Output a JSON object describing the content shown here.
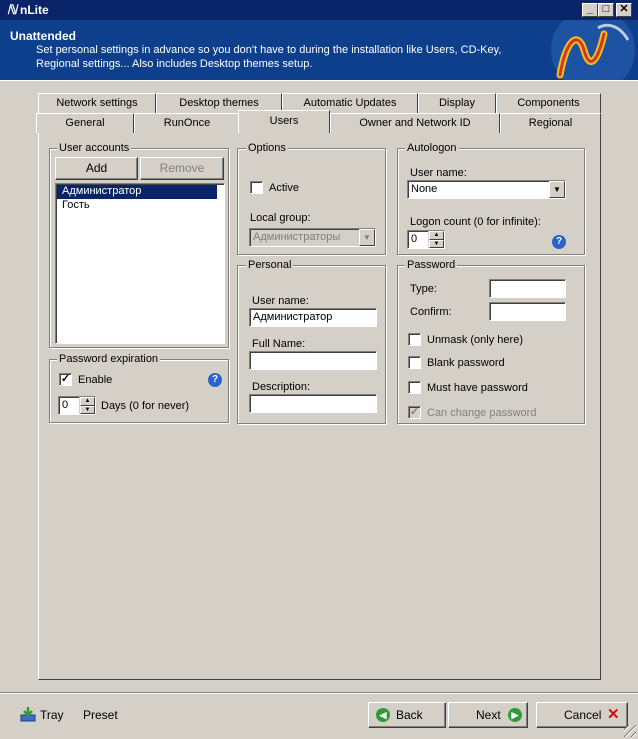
{
  "window": {
    "title": "nLite",
    "minimize": "_",
    "maximize": "□",
    "close": "✕"
  },
  "banner": {
    "heading": "Unattended",
    "description": "Set personal settings in advance so you don't have to during the installation like Users, CD-Key, Regional settings... Also includes Desktop themes setup."
  },
  "tabs_row1": [
    "Network settings",
    "Desktop themes",
    "Automatic Updates",
    "Display",
    "Components"
  ],
  "tabs_row2": [
    "General",
    "RunOnce",
    "Users",
    "Owner and Network ID",
    "Regional"
  ],
  "selected_tab": "Users",
  "user_accounts": {
    "title": "User accounts",
    "add_label": "Add",
    "remove_label": "Remove",
    "items": [
      "Администратор",
      "Гость"
    ],
    "selected": "Администратор"
  },
  "password_expiration": {
    "title": "Password expiration",
    "enable_label": "Enable",
    "enabled": true,
    "days_value": "0",
    "days_label": "Days (0 for never)"
  },
  "options": {
    "title": "Options",
    "active_label": "Active",
    "active": false,
    "local_group_label": "Local group:",
    "local_group_value": "Администраторы"
  },
  "personal": {
    "title": "Personal",
    "user_name_label": "User name:",
    "user_name_value": "Администратор",
    "full_name_label": "Full Name:",
    "full_name_value": "",
    "description_label": "Description:",
    "description_value": ""
  },
  "autologon": {
    "title": "Autologon",
    "user_name_label": "User name:",
    "user_name_value": "None",
    "logon_count_label": "Logon count (0 for infinite):",
    "logon_count_value": "0"
  },
  "password": {
    "title": "Password",
    "type_label": "Type:",
    "confirm_label": "Confirm:",
    "unmask_label": "Unmask (only here)",
    "blank_label": "Blank password",
    "must_have_label": "Must have password",
    "can_change_label": "Can change password",
    "unmask": false,
    "blank": false,
    "must_have": false,
    "can_change": true
  },
  "footer": {
    "tray_label": "Tray",
    "preset_label": "Preset",
    "back_label": "Back",
    "next_label": "Next",
    "cancel_label": "Cancel"
  },
  "icons": {
    "help": "help-icon",
    "tray": "tray-icon",
    "back": "back-arrow-icon",
    "next": "next-arrow-icon",
    "cancel": "cancel-x-icon"
  },
  "colors": {
    "banner": "#0d3f8d",
    "titlebar": "#0a246a",
    "face": "#d4d0c8",
    "selection": "#0a246a"
  }
}
